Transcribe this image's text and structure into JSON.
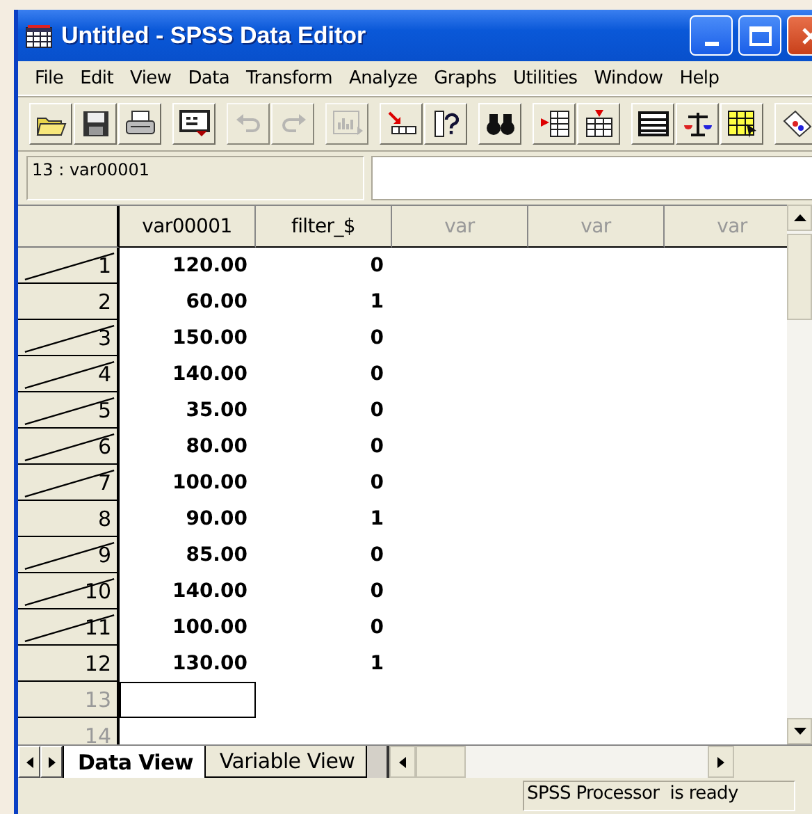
{
  "window": {
    "title": "Untitled - SPSS Data Editor"
  },
  "menu": [
    "File",
    "Edit",
    "View",
    "Data",
    "Transform",
    "Analyze",
    "Graphs",
    "Utilities",
    "Window",
    "Help"
  ],
  "toolbar": [
    {
      "kind": "open",
      "disabled": false
    },
    {
      "kind": "save",
      "disabled": false
    },
    {
      "kind": "print",
      "disabled": false
    },
    {
      "kind": "recall",
      "disabled": false
    },
    {
      "kind": "undo",
      "disabled": true
    },
    {
      "kind": "redo",
      "disabled": true
    },
    {
      "kind": "chart",
      "disabled": true
    },
    {
      "kind": "goto",
      "disabled": false
    },
    {
      "kind": "varinfo",
      "disabled": false
    },
    {
      "kind": "find",
      "disabled": false
    },
    {
      "kind": "insertcase",
      "disabled": false
    },
    {
      "kind": "insertvar",
      "disabled": false
    },
    {
      "kind": "split",
      "disabled": false
    },
    {
      "kind": "weight",
      "disabled": false
    },
    {
      "kind": "select",
      "disabled": false
    },
    {
      "kind": "labels",
      "disabled": false
    }
  ],
  "cell_editor": {
    "reference": "13 : var00001"
  },
  "table": {
    "columns": [
      {
        "label": "var00001",
        "empty": false
      },
      {
        "label": "filter_$",
        "empty": false
      },
      {
        "label": "var",
        "empty": true
      },
      {
        "label": "var",
        "empty": true
      },
      {
        "label": "var",
        "empty": true
      }
    ],
    "rows": [
      {
        "number": "1",
        "filtered_out": true,
        "cells": [
          "120.00",
          "0"
        ]
      },
      {
        "number": "2",
        "filtered_out": false,
        "cells": [
          "60.00",
          "1"
        ]
      },
      {
        "number": "3",
        "filtered_out": true,
        "cells": [
          "150.00",
          "0"
        ]
      },
      {
        "number": "4",
        "filtered_out": true,
        "cells": [
          "140.00",
          "0"
        ]
      },
      {
        "number": "5",
        "filtered_out": true,
        "cells": [
          "35.00",
          "0"
        ]
      },
      {
        "number": "6",
        "filtered_out": true,
        "cells": [
          "80.00",
          "0"
        ]
      },
      {
        "number": "7",
        "filtered_out": true,
        "cells": [
          "100.00",
          "0"
        ]
      },
      {
        "number": "8",
        "filtered_out": false,
        "cells": [
          "90.00",
          "1"
        ]
      },
      {
        "number": "9",
        "filtered_out": true,
        "cells": [
          "85.00",
          "0"
        ]
      },
      {
        "number": "10",
        "filtered_out": true,
        "cells": [
          "140.00",
          "0"
        ]
      },
      {
        "number": "11",
        "filtered_out": true,
        "cells": [
          "100.00",
          "0"
        ]
      },
      {
        "number": "12",
        "filtered_out": false,
        "cells": [
          "130.00",
          "1"
        ]
      },
      {
        "number": "13",
        "filtered_out": false,
        "active_cell": true,
        "cells": []
      },
      {
        "number": "14",
        "filtered_out": false,
        "cells": []
      }
    ]
  },
  "tabs": [
    {
      "label": "Data View",
      "selected": true
    },
    {
      "label": "Variable View",
      "selected": false
    }
  ],
  "status_bar": {
    "text": "SPSS Processor  is ready"
  }
}
